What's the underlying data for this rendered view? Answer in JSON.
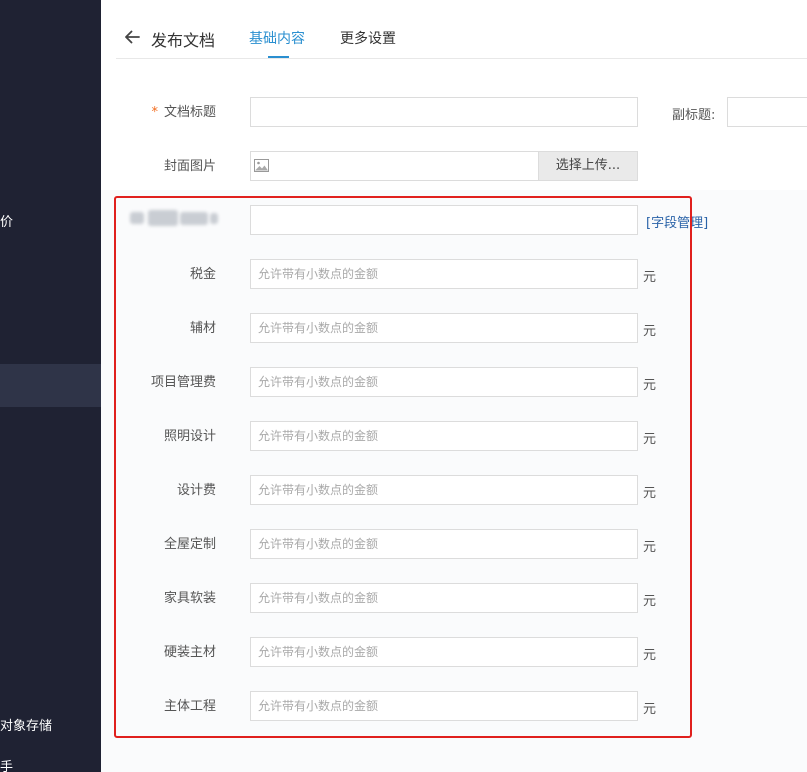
{
  "sidebar": {
    "items": [
      {
        "label": "价"
      },
      {
        "label": "对象存储"
      },
      {
        "label": "手"
      }
    ]
  },
  "header": {
    "back_icon": "arrow-left-icon",
    "title": "发布文档",
    "tabs": [
      {
        "label": "基础内容",
        "active": true
      },
      {
        "label": "更多设置",
        "active": false
      }
    ]
  },
  "form": {
    "doc_title_label": "文档标题",
    "required_mark": "*",
    "subtitle_label": "副标题:",
    "cover_label": "封面图片",
    "upload_label": "选择上传...",
    "field_manage_label": "[字段管理]",
    "amount_placeholder": "允许带有小数点的金额",
    "unit": "元",
    "amount_fields": [
      {
        "label": "税金"
      },
      {
        "label": "辅材"
      },
      {
        "label": "项目管理费"
      },
      {
        "label": "照明设计"
      },
      {
        "label": "设计费"
      },
      {
        "label": "全屋定制"
      },
      {
        "label": "家具软装"
      },
      {
        "label": "硬装主材"
      },
      {
        "label": "主体工程"
      }
    ]
  },
  "colors": {
    "accent": "#2a8fd0",
    "sidebar_bg": "#1f2233",
    "required": "#f26b1d",
    "highlight_frame": "#e0201d"
  }
}
